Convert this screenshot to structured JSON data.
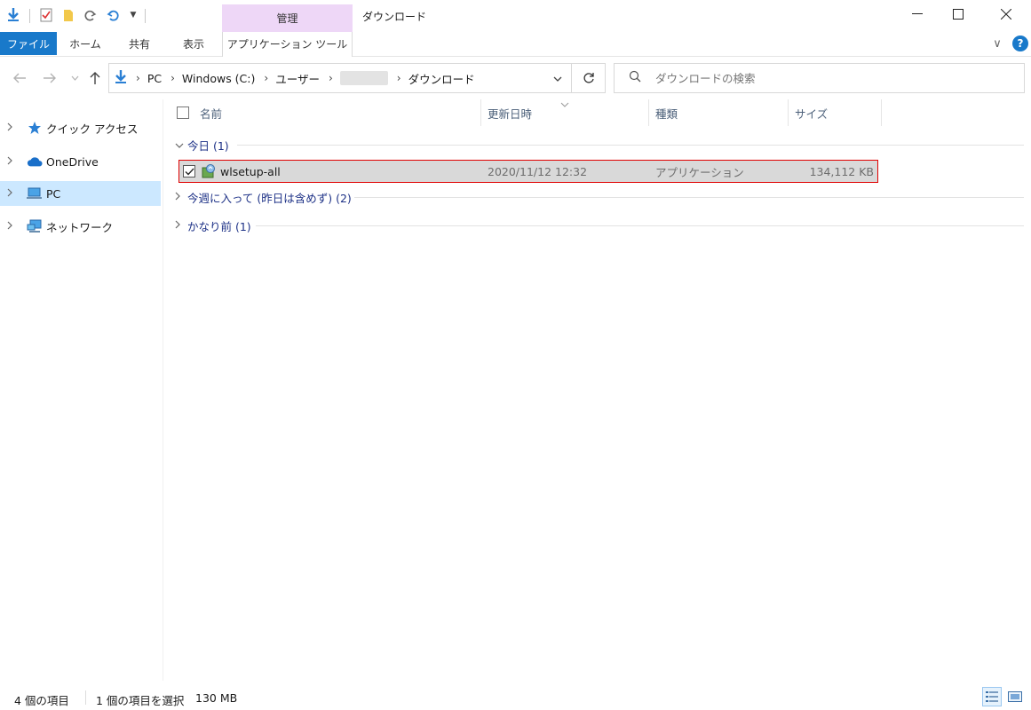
{
  "window": {
    "title": "ダウンロード",
    "context_tab_group": "管理",
    "minimize": "—",
    "maximize": "☐",
    "close": "✕"
  },
  "ribbon": {
    "tabs": [
      "ファイル",
      "ホーム",
      "共有",
      "表示",
      "アプリケーション ツール"
    ],
    "collapse_glyph": "∨",
    "help_glyph": "?"
  },
  "address": {
    "crumbs": [
      "PC",
      "Windows (C:)",
      "ユーザー",
      "",
      "ダウンロード"
    ],
    "search_placeholder": "ダウンロードの検索"
  },
  "nav": {
    "items": [
      {
        "label": "クイック アクセス",
        "icon": "star-icon"
      },
      {
        "label": "OneDrive",
        "icon": "cloud-icon"
      },
      {
        "label": "PC",
        "icon": "computer-icon"
      },
      {
        "label": "ネットワーク",
        "icon": "network-icon"
      }
    ]
  },
  "columns": {
    "name": "名前",
    "modified": "更新日時",
    "type": "種類",
    "size": "サイズ"
  },
  "groups": {
    "today": "今日 (1)",
    "this_week": "今週に入って (昨日は含めず) (2)",
    "long_ago": "かなり前 (1)"
  },
  "files": [
    {
      "name": "wlsetup-all",
      "modified": "2020/11/12 12:32",
      "type": "アプリケーション",
      "size": "134,112 KB",
      "checked": true
    }
  ],
  "status": {
    "count": "4 個の項目",
    "selection": "1 個の項目を選択",
    "selection_size": "130 MB"
  },
  "colors": {
    "file_tab": "#1979ca",
    "context_tab": "#eed7f7",
    "selected_nav": "#cce8ff",
    "highlight_border": "#e00000"
  }
}
